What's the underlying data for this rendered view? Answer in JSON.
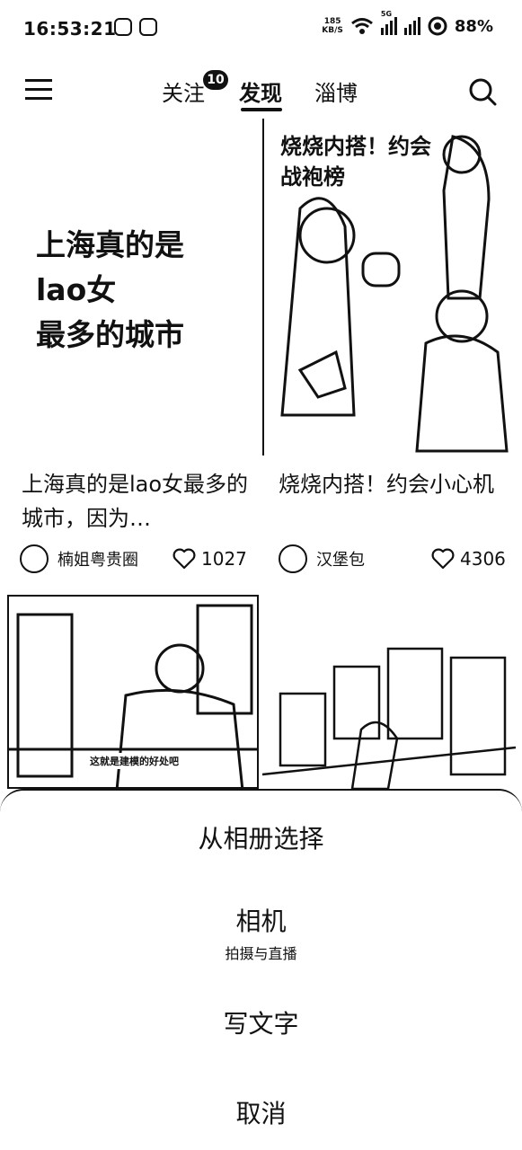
{
  "status_bar": {
    "time": "16:53:21",
    "net_speed_value": "185",
    "net_speed_unit": "KB/S",
    "signal_tag": "5G",
    "battery": "88%"
  },
  "nav": {
    "tabs": [
      {
        "label": "关注",
        "badge": "10"
      },
      {
        "label": "发现"
      },
      {
        "label": "淄博"
      }
    ],
    "active_tab": "发现"
  },
  "feed": {
    "cards": [
      {
        "cover_text": "上海真的是\nlao女\n最多的城市",
        "title": "上海真的是lao女最多的城市，因为…",
        "author": "楠姐粤贵圈",
        "likes": "1027"
      },
      {
        "cover_text": "烧烧内搭！约会战袍榜",
        "title": "烧烧内搭！约会小心机",
        "author": "汉堡包",
        "likes": "4306"
      },
      {
        "cover_caption": "这就是建模的好处吧"
      },
      {}
    ]
  },
  "action_sheet": {
    "items": [
      {
        "label": "从相册选择"
      },
      {
        "label": "相机",
        "sub": "拍摄与直播"
      },
      {
        "label": "写文字"
      }
    ],
    "cancel": "取消"
  },
  "icons": [
    "menu-icon",
    "search-icon",
    "heart-icon",
    "wifi-icon",
    "signal-icon",
    "battery-icon"
  ]
}
